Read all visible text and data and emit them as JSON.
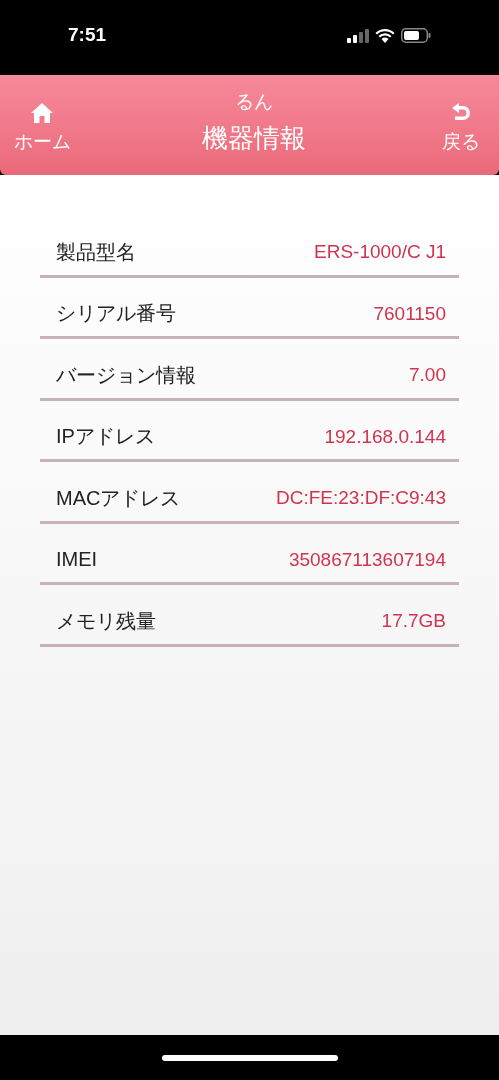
{
  "status_bar": {
    "time": "7:51"
  },
  "header": {
    "home_label": "ホーム",
    "subtitle": "るん",
    "title": "機器情報",
    "back_label": "戻る"
  },
  "rows": [
    {
      "label": "製品型名",
      "value": "ERS-1000/C J1"
    },
    {
      "label": "シリアル番号",
      "value": "7601150"
    },
    {
      "label": "バージョン情報",
      "value": "7.00"
    },
    {
      "label": "IPアドレス",
      "value": "192.168.0.144"
    },
    {
      "label": "MACアドレス",
      "value": "DC:FE:23:DF:C9:43"
    },
    {
      "label": "IMEI",
      "value": "350867113607194"
    },
    {
      "label": "メモリ残量",
      "value": "17.7GB"
    }
  ]
}
